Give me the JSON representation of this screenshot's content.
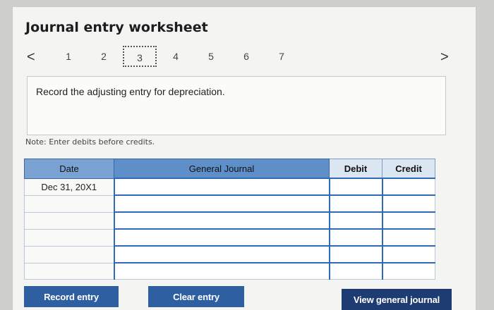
{
  "title": "Journal entry worksheet",
  "pager": {
    "prev": "<",
    "next": ">",
    "pages": [
      "1",
      "2",
      "3",
      "4",
      "5",
      "6",
      "7"
    ],
    "active_index": 2
  },
  "instruction": "Record the adjusting entry for depreciation.",
  "note": "Note: Enter debits before credits.",
  "table": {
    "headers": {
      "date": "Date",
      "general_journal": "General Journal",
      "debit": "Debit",
      "credit": "Credit"
    },
    "rows": [
      {
        "date": "Dec 31, 20X1"
      },
      {
        "date": ""
      },
      {
        "date": ""
      },
      {
        "date": ""
      },
      {
        "date": ""
      },
      {
        "date": ""
      }
    ]
  },
  "buttons": {
    "record": "Record entry",
    "clear": "Clear entry",
    "view": "View general journal"
  }
}
